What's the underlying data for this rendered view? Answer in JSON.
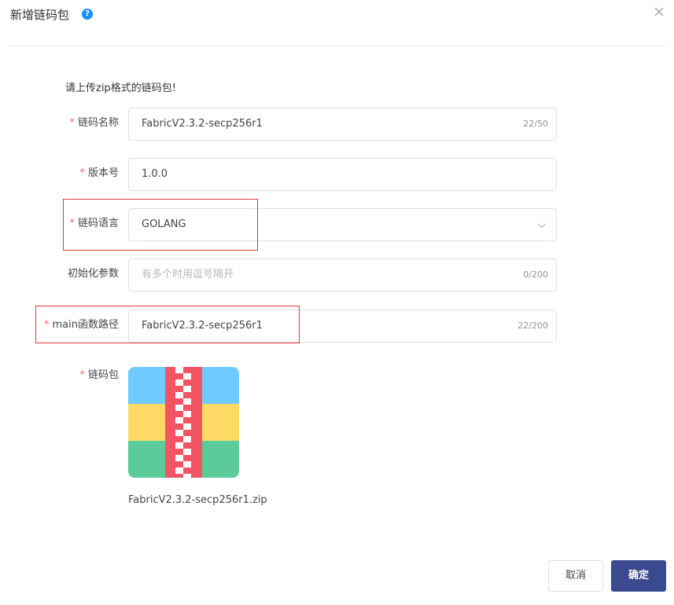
{
  "dialog": {
    "title": "新增链码包",
    "help_icon": "question-circle-icon",
    "close_icon": "close-icon"
  },
  "hint": "请上传zip格式的链码包!",
  "form": {
    "required_mark": "*",
    "name": {
      "label": "链码名称",
      "value": "FabricV2.3.2-secp256r1",
      "count": "22/50"
    },
    "version": {
      "label": "版本号",
      "value": "1.0.0"
    },
    "language": {
      "label": "链码语言",
      "value": "GOLANG"
    },
    "init_params": {
      "label": "初始化参数",
      "placeholder": "有多个时用逗号隔开",
      "count": "0/200"
    },
    "main_path": {
      "label": "main函数路径",
      "value": "FabricV2.3.2-secp256r1",
      "count": "22/200"
    },
    "package": {
      "label": "链码包",
      "file_name": "FabricV2.3.2-secp256r1.zip",
      "icon": "zip-file-icon"
    }
  },
  "footer": {
    "cancel_label": "取消",
    "ok_label": "确定"
  },
  "colors": {
    "accent": "#3b4a8f",
    "required": "#f56c6c",
    "highlight_box": "#e53935",
    "help_icon": "#1890ff",
    "zip_blue": "#6ecbff",
    "zip_yellow": "#ffd966",
    "zip_green": "#5ccb9a",
    "zip_red": "#f25464"
  }
}
